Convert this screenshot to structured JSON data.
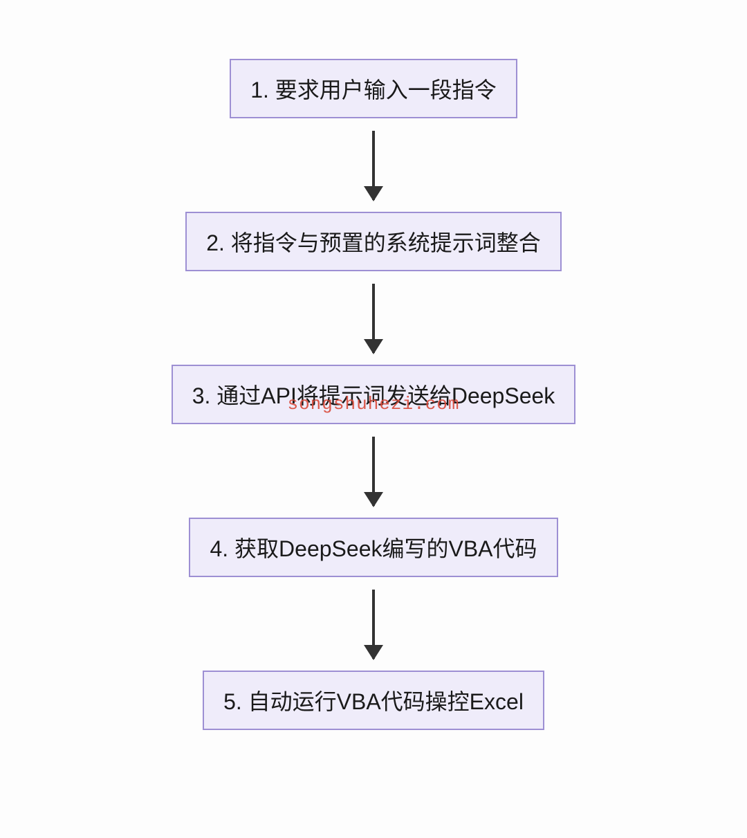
{
  "steps": [
    {
      "label": "1. 要求用户输入一段指令"
    },
    {
      "label": "2. 将指令与预置的系统提示词整合"
    },
    {
      "label": "3. 通过API将提示词发送给DeepSeek"
    },
    {
      "label": "4. 获取DeepSeek编写的VBA代码"
    },
    {
      "label": "5. 自动运行VBA代码操控Excel"
    }
  ],
  "watermark": "songshuhezi.com",
  "colors": {
    "node_bg": "#efecfa",
    "node_border": "#9d8fd3",
    "arrow": "#333333",
    "watermark": "#d94a3a"
  }
}
